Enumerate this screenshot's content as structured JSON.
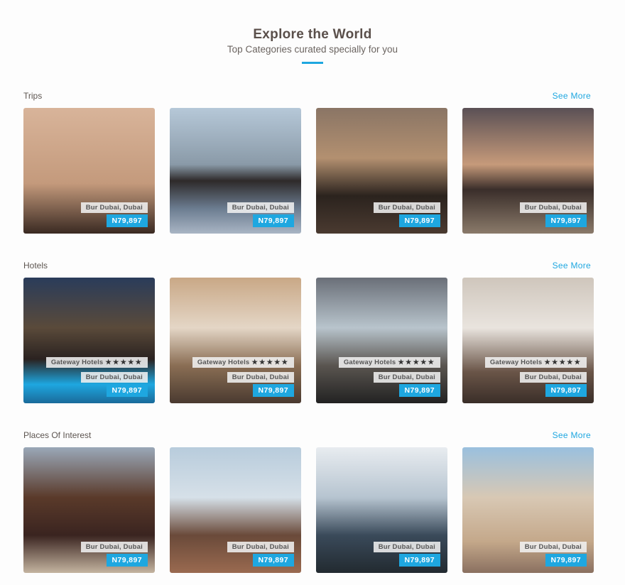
{
  "header": {
    "title": "Explore the World",
    "subtitle": "Top Categories curated specially for you"
  },
  "sections": [
    {
      "title": "Trips",
      "see_more": "See More",
      "cards": [
        {
          "location": "Bur Dubai, Dubai",
          "price": "N79,897"
        },
        {
          "location": "Bur Dubai, Dubai",
          "price": "N79,897"
        },
        {
          "location": "Bur Dubai, Dubai",
          "price": "N79,897"
        },
        {
          "location": "Bur Dubai, Dubai",
          "price": "N79,897"
        }
      ]
    },
    {
      "title": "Hotels",
      "see_more": "See More",
      "cards": [
        {
          "hotel": "Gateway Hotels",
          "stars": "★★★★★",
          "location": "Bur Dubai, Dubai",
          "price": "N79,897"
        },
        {
          "hotel": "Gateway Hotels",
          "stars": "★★★★★",
          "location": "Bur Dubai, Dubai",
          "price": "N79,897"
        },
        {
          "hotel": "Gateway Hotels",
          "stars": "★★★★★",
          "location": "Bur Dubai, Dubai",
          "price": "N79,897"
        },
        {
          "hotel": "Gateway Hotels",
          "stars": "★★★★★",
          "location": "Bur Dubai, Dubai",
          "price": "N79,897"
        }
      ]
    },
    {
      "title": "Places Of Interest",
      "see_more": "See More",
      "cards": [
        {
          "location": "Bur Dubai, Dubai",
          "price": "N79,897"
        },
        {
          "location": "Bur Dubai, Dubai",
          "price": "N79,897"
        },
        {
          "location": "Bur Dubai, Dubai",
          "price": "N79,897"
        },
        {
          "location": "Bur Dubai, Dubai",
          "price": "N79,897"
        }
      ]
    }
  ]
}
